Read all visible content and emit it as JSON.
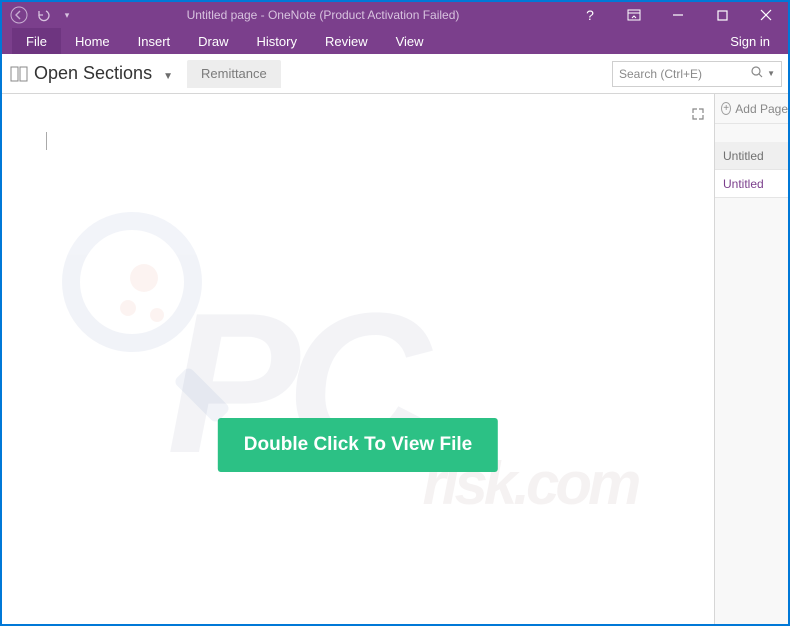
{
  "titlebar": {
    "title": "Untitled page - OneNote (Product Activation Failed)"
  },
  "ribbon": {
    "file": "File",
    "tabs": [
      "Home",
      "Insert",
      "Draw",
      "History",
      "Review",
      "View"
    ],
    "signin": "Sign in"
  },
  "section": {
    "open_sections": "Open Sections",
    "tab": "Remittance"
  },
  "search": {
    "placeholder": "Search (Ctrl+E)"
  },
  "side": {
    "add_page": "Add Page",
    "pages": [
      "Untitled",
      "Untitled"
    ]
  },
  "canvas": {
    "button_label": "Double Click To View File"
  }
}
